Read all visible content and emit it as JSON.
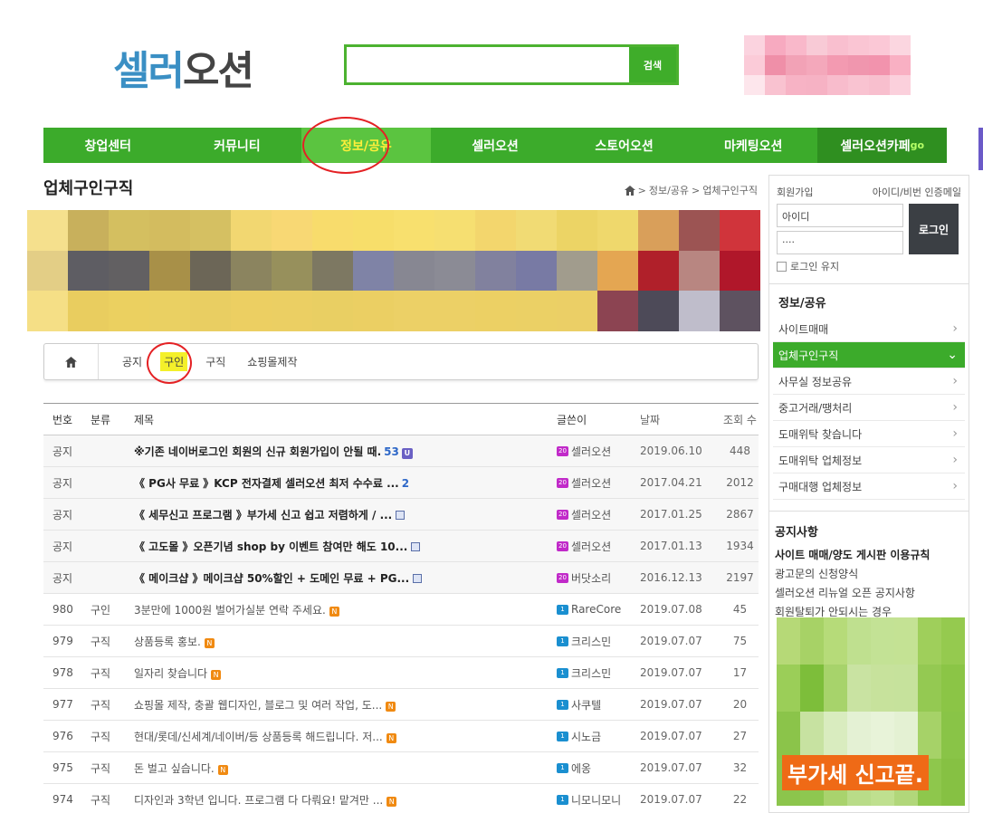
{
  "logo": {
    "part1": "셀러",
    "part2": "오션"
  },
  "search": {
    "placeholder": "",
    "button": "검색"
  },
  "nav": [
    "창업센터",
    "커뮤니티",
    "정보/공유",
    "셀러오션",
    "스토어오션",
    "마케팅오션"
  ],
  "nav_cafe": {
    "label": "셀러오션카페",
    "suffix": "go"
  },
  "page_title": "업체구인구직",
  "breadcrumb": {
    "sep": ">",
    "items": [
      "정보/공유",
      "업체구인구직"
    ]
  },
  "subtabs": [
    "공지",
    "구인",
    "구직",
    "쇼핑몰제작"
  ],
  "table": {
    "headers": {
      "no": "번호",
      "cat": "분류",
      "title": "제목",
      "writer": "글쓴이",
      "date": "날짜",
      "views": "조회 수"
    },
    "notices": [
      {
        "no": "공지",
        "title": "※기존 네이버로그인 회원의 신규 회원가입이 안될 때.",
        "count": "53",
        "writer": "셀러오션",
        "date": "2019.06.10",
        "views": "448"
      },
      {
        "no": "공지",
        "title": "《 PG사 무료 》KCP 전자결제 셀러오션 최저 수수료 ...",
        "count": "2",
        "writer": "셀러오션",
        "date": "2017.04.21",
        "views": "2012"
      },
      {
        "no": "공지",
        "title": "《 세무신고 프로그램 》부가세 신고 쉽고 저렴하게 / ...",
        "writer": "셀러오션",
        "date": "2017.01.25",
        "views": "2867"
      },
      {
        "no": "공지",
        "title": "《 고도몰 》오픈기념 shop by 이벤트 참여만 해도 10...",
        "writer": "셀러오션",
        "date": "2017.01.13",
        "views": "1934"
      },
      {
        "no": "공지",
        "title": "《 메이크샵 》메이크샵 50%할인 + 도메인 무료 + PG...",
        "writer": "버닷소리",
        "date": "2016.12.13",
        "views": "2197"
      }
    ],
    "rows": [
      {
        "no": "980",
        "cat": "구인",
        "title": "3분만에 1000원 벌어가실분 연락 주세요.",
        "writer": "RareCore",
        "date": "2019.07.08",
        "views": "45"
      },
      {
        "no": "979",
        "cat": "구직",
        "title": "상품등록 홍보.",
        "writer": "크리스민",
        "date": "2019.07.07",
        "views": "75"
      },
      {
        "no": "978",
        "cat": "구직",
        "title": "일자리 찾습니다",
        "writer": "크리스민",
        "date": "2019.07.07",
        "views": "17"
      },
      {
        "no": "977",
        "cat": "구직",
        "title": "쇼핑몰 제작, 충괄 웹디자인, 블로그 및 여러 작업, 도...",
        "writer": "사쿠텔",
        "date": "2019.07.07",
        "views": "20"
      },
      {
        "no": "976",
        "cat": "구직",
        "title": "현대/롯데/신세계/네이버/등 상품등록 해드립니다. 저...",
        "writer": "시노금",
        "date": "2019.07.07",
        "views": "27"
      },
      {
        "no": "975",
        "cat": "구직",
        "title": "돈 벌고 싶습니다.",
        "writer": "에옹",
        "date": "2019.07.07",
        "views": "32"
      },
      {
        "no": "974",
        "cat": "구직",
        "title": "디자인과 3학년 입니다. 프로그램 다 다뤄요! 맡겨만 ...",
        "writer": "니모니모니",
        "date": "2019.07.07",
        "views": "22"
      }
    ]
  },
  "sidebar": {
    "signup": "회원가입",
    "find": "아이디/비번 인증메일",
    "id_value": "아이디",
    "pw_value": "····",
    "login_btn": "로그인",
    "keep": "로그인 유지",
    "section_title": "정보/공유",
    "items": [
      "사이트매매",
      "업체구인구직",
      "사무실 정보공유",
      "중고거래/땡처리",
      "도매위탁 찾습니다",
      "도매위탁 업체정보",
      "구매대행 업체정보"
    ],
    "notice_title": "공지사항",
    "notices": [
      "사이트 매매/양도 게시판 이용규칙",
      "광고문의 신청양식",
      "셀러오션 리뉴얼 오픈 공지사항",
      "회원탈퇴가 안되시는 경우"
    ],
    "ad_text": "부가세 신고끝."
  },
  "colors": {
    "nav_green": "#3cab2b",
    "accent_red_circle": "#e42124",
    "active_text": "#ffef3a"
  }
}
